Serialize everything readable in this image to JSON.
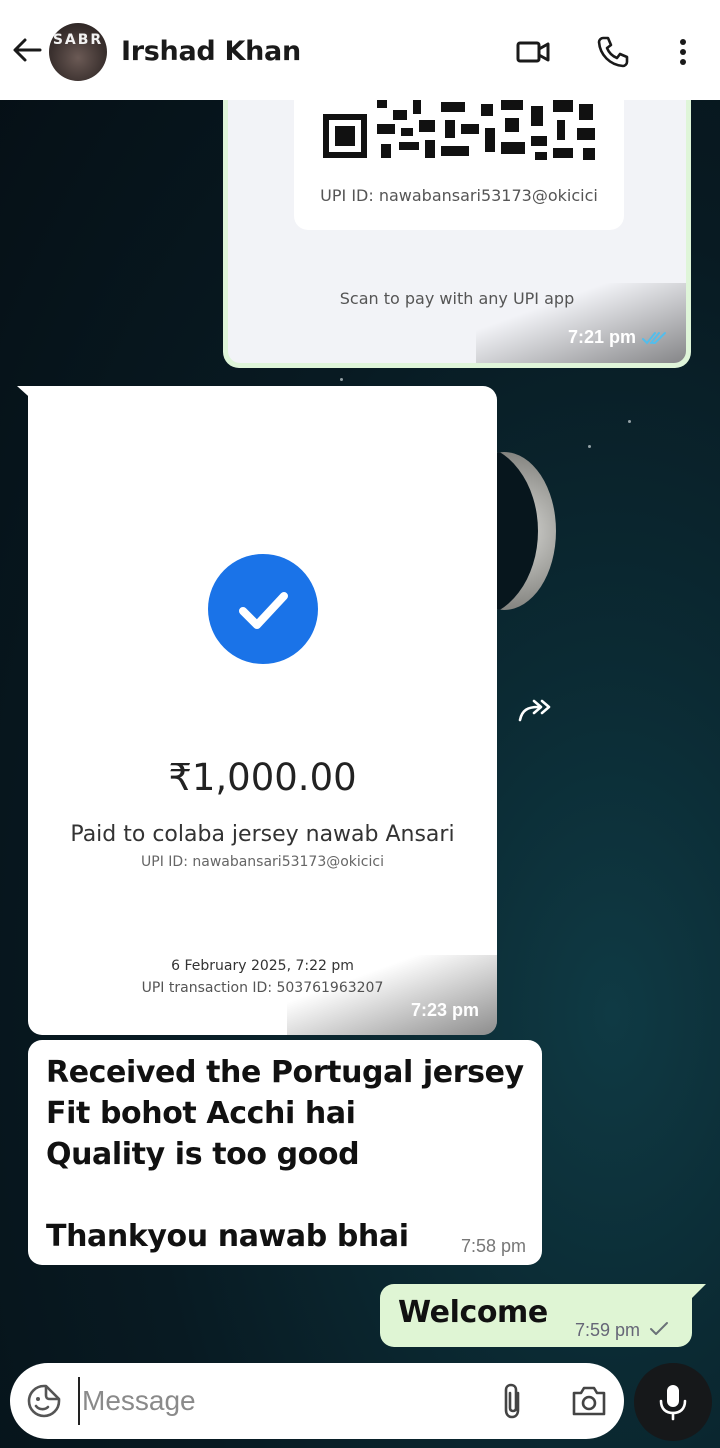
{
  "header": {
    "contact_name": "Irshad Khan",
    "avatar_text": "SABR",
    "icons": [
      "back-arrow-icon",
      "video-call-icon",
      "phone-icon",
      "more-vert-icon"
    ]
  },
  "messages": [
    {
      "type": "image",
      "direction": "outgoing",
      "content": {
        "upi_id": "UPI ID: nawabansari53173@okicici",
        "caption": "Scan to pay with any UPI app"
      },
      "time": "7:21 pm",
      "status": "read"
    },
    {
      "type": "image",
      "direction": "incoming",
      "content": {
        "amount": "₹1,000.00",
        "paid_to": "Paid to colaba jersey nawab Ansari",
        "upi_id": "UPI ID: nawabansari53173@okicici",
        "date": "6 February 2025, 7:22 pm",
        "transaction_id": "UPI transaction ID: 503761963207"
      },
      "time": "7:23 pm"
    },
    {
      "type": "text",
      "direction": "incoming",
      "text": "Received the Portugal jersey\nFit bohot Acchi hai\nQuality is too good\n\nThankyou nawab bhai",
      "time": "7:58 pm"
    },
    {
      "type": "text",
      "direction": "outgoing",
      "text": "Welcome",
      "time": "7:59 pm",
      "status": "sent"
    }
  ],
  "composer": {
    "placeholder": "Message"
  },
  "colors": {
    "outgoing_bubble": "#dff5d4",
    "incoming_bubble": "#ffffff",
    "read_tick": "#53bdeb",
    "check_blue": "#1a73e8"
  }
}
